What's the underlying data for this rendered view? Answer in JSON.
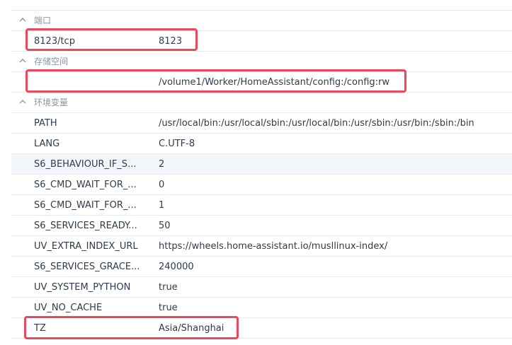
{
  "sections": {
    "ports": {
      "title": "端口"
    },
    "storage": {
      "title": "存储空间"
    },
    "env": {
      "title": "环境变量"
    }
  },
  "ports": [
    {
      "container_port": "8123/tcp",
      "host_port": "8123"
    }
  ],
  "storage": [
    {
      "folder": "",
      "mount": "/volume1/Worker/HomeAssistant/config:/config:rw"
    }
  ],
  "env": [
    {
      "key": "PATH",
      "value": "/usr/local/bin:/usr/local/sbin:/usr/local/bin:/usr/sbin:/usr/bin:/sbin:/bin"
    },
    {
      "key": "LANG",
      "value": "C.UTF-8"
    },
    {
      "key": "S6_BEHAVIOUR_IF_S...",
      "value": "2"
    },
    {
      "key": "S6_CMD_WAIT_FOR_...",
      "value": "0"
    },
    {
      "key": "S6_CMD_WAIT_FOR_...",
      "value": "1"
    },
    {
      "key": "S6_SERVICES_READY...",
      "value": "50"
    },
    {
      "key": "UV_EXTRA_INDEX_URL",
      "value": "https://wheels.home-assistant.io/musllinux-index/"
    },
    {
      "key": "S6_SERVICES_GRACE...",
      "value": "240000"
    },
    {
      "key": "UV_SYSTEM_PYTHON",
      "value": "true"
    },
    {
      "key": "UV_NO_CACHE",
      "value": "true"
    },
    {
      "key": "TZ",
      "value": "Asia/Shanghai"
    }
  ],
  "colors": {
    "highlight_box": "#e8495d",
    "hover_row": "#f3f6fa",
    "header_text": "#8a96a3"
  },
  "icons": {
    "section_toggle": "chevron-up-icon"
  }
}
